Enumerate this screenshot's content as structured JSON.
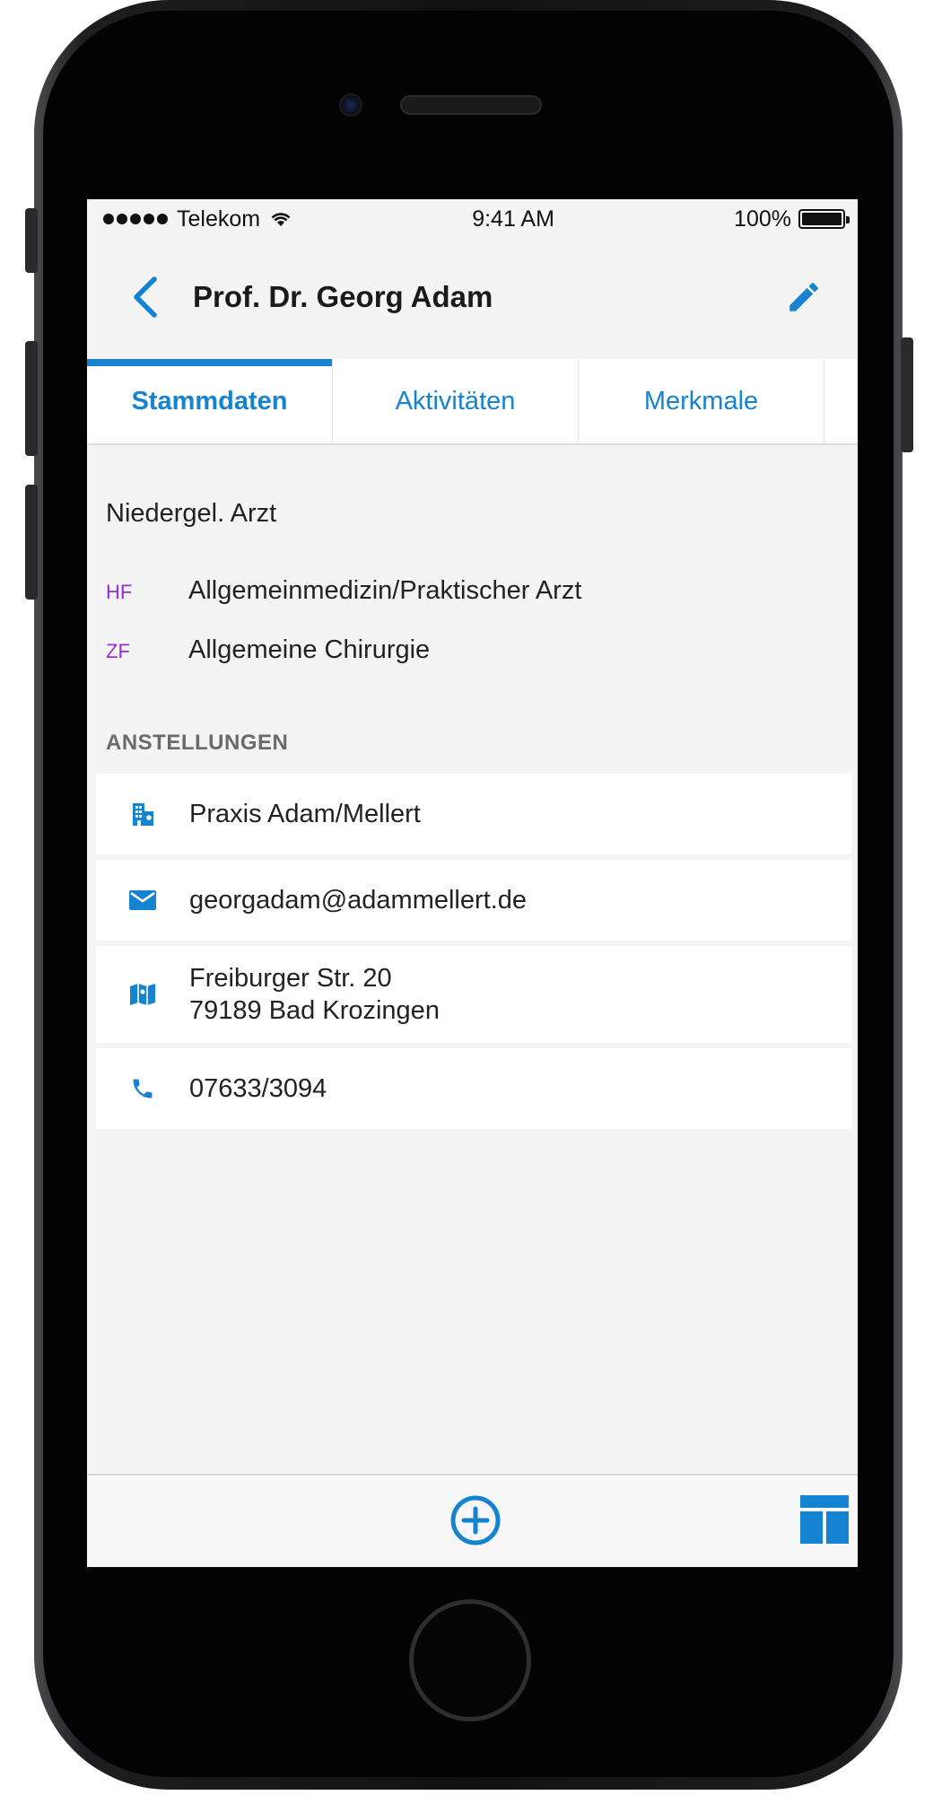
{
  "status_bar": {
    "carrier": "Telekom",
    "time": "9:41 AM",
    "battery": "100%",
    "icons": [
      "signal-dots-icon",
      "wifi-icon",
      "battery-icon"
    ]
  },
  "nav": {
    "title": "Prof. Dr. Georg Adam",
    "back_icon": "chevron-left-icon",
    "edit_icon": "pencil-icon"
  },
  "tabs": [
    {
      "label": "Stammdaten",
      "active": true
    },
    {
      "label": "Aktivitäten",
      "active": false
    },
    {
      "label": "Merkmale",
      "active": false
    }
  ],
  "profile": {
    "category": "Niedergel. Arzt",
    "specialties": [
      {
        "code": "HF",
        "label": "Allgemeinmedizin/Praktischer Arzt"
      },
      {
        "code": "ZF",
        "label": "Allgemeine Chirurgie"
      }
    ]
  },
  "section": {
    "title": "ANSTELLUNGEN"
  },
  "items": [
    {
      "icon": "building-icon",
      "text": "Praxis Adam/Mellert"
    },
    {
      "icon": "mail-icon",
      "text": "georgadam@adammellert.de"
    },
    {
      "icon": "map-icon",
      "line1": "Freiburger Str. 20",
      "line2": "79189 Bad Krozingen"
    },
    {
      "icon": "phone-icon",
      "text": "07633/3094"
    }
  ],
  "bottom_bar": {
    "add_icon": "plus-circle-icon",
    "layout_icon": "layout-icon"
  },
  "colors": {
    "accent": "#1583d0",
    "code": "#9a2bd8",
    "background": "#f4f4f4"
  }
}
